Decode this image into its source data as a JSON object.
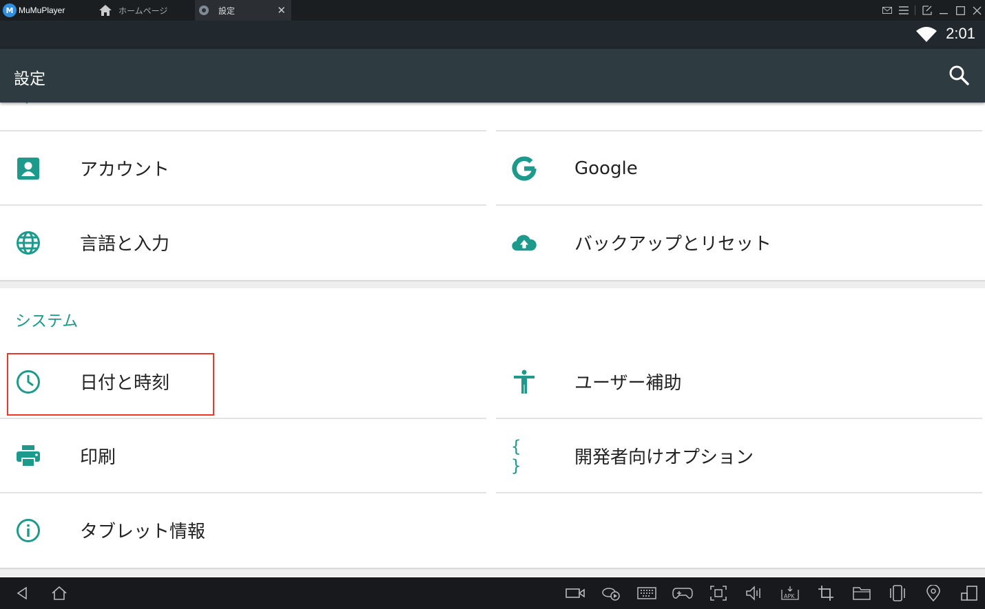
{
  "titlebar": {
    "app_name": "MuMuPlayer",
    "logo_letter": "M",
    "tabs": [
      {
        "label": "ホームページ",
        "icon": "home-icon"
      },
      {
        "label": "設定",
        "icon": "gear-icon"
      }
    ]
  },
  "statusbar": {
    "time": "2:01"
  },
  "appbar": {
    "title": "設定"
  },
  "settings": {
    "left_items": [
      {
        "label": "アカウント",
        "icon": "account-box-icon"
      },
      {
        "label": "言語と入力",
        "icon": "globe-icon"
      }
    ],
    "right_items": [
      {
        "label": "Google",
        "icon": "google-g-icon"
      },
      {
        "label": "バックアップとリセット",
        "icon": "cloud-upload-icon"
      }
    ]
  },
  "system": {
    "title": "システム",
    "left_items": [
      {
        "label": "日付と時刻",
        "icon": "clock-icon"
      },
      {
        "label": "印刷",
        "icon": "printer-icon"
      },
      {
        "label": "タブレット情報",
        "icon": "info-icon"
      }
    ],
    "right_items": [
      {
        "label": "ユーザー補助",
        "icon": "accessibility-icon"
      },
      {
        "label": "開発者向けオプション",
        "icon": "developer-braces-icon"
      }
    ]
  },
  "colors": {
    "accent": "#1e9a8c",
    "appbar": "#2e3b41",
    "statusbar": "#22292e",
    "highlight": "#e83a2a"
  }
}
